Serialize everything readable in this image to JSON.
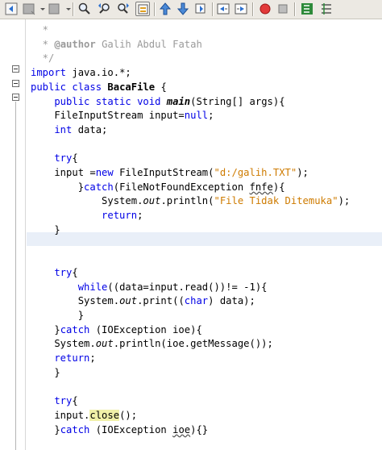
{
  "toolbar": {
    "buttons": [
      {
        "name": "back-icon"
      },
      {
        "name": "forward-icon"
      },
      {
        "name": "last-edit-icon"
      },
      {
        "name": "find-selection-icon"
      },
      {
        "name": "find-previous-icon"
      },
      {
        "name": "find-next-icon"
      },
      {
        "name": "toggle-highlight-icon"
      },
      {
        "name": "previous-bookmark-icon"
      },
      {
        "name": "next-bookmark-icon"
      },
      {
        "name": "toggle-bookmark-icon"
      },
      {
        "name": "shift-left-icon"
      },
      {
        "name": "shift-right-icon"
      },
      {
        "name": "start-macro-icon"
      },
      {
        "name": "stop-macro-icon"
      },
      {
        "name": "comment-icon"
      },
      {
        "name": "uncomment-icon"
      }
    ],
    "colors": {
      "background": "#ece9e3",
      "record": "#e23a3a"
    }
  },
  "editor": {
    "colors": {
      "keyword": "#0000e6",
      "comment": "#9a9a9a",
      "string": "#ce7b00",
      "current_line": "#e9eff8"
    },
    "lines": [
      {
        "id": "l1",
        "t": [
          {
            "c": "cmt",
            "v": "  *"
          }
        ]
      },
      {
        "id": "l2",
        "t": [
          {
            "c": "cmt",
            "v": "  * "
          },
          {
            "c": "cmt bold",
            "v": "@author"
          },
          {
            "c": "cmt",
            "v": " Galih Abdul Fatah"
          }
        ]
      },
      {
        "id": "l3",
        "t": [
          {
            "c": "cmt",
            "v": "  */"
          }
        ]
      },
      {
        "id": "l4",
        "t": [
          {
            "c": "kw",
            "v": "import"
          },
          {
            "c": "",
            "v": " java.io.*;"
          }
        ]
      },
      {
        "id": "l5",
        "t": [
          {
            "c": "kw",
            "v": "public class"
          },
          {
            "c": "",
            "v": " "
          },
          {
            "c": "bold",
            "v": "BacaFile"
          },
          {
            "c": "",
            "v": " {"
          }
        ]
      },
      {
        "id": "l6",
        "t": [
          {
            "c": "kw",
            "v": "    public static void"
          },
          {
            "c": "",
            "v": " "
          },
          {
            "c": "bi",
            "v": "main"
          },
          {
            "c": "",
            "v": "(String[] args){"
          }
        ]
      },
      {
        "id": "l7",
        "t": [
          {
            "c": "",
            "v": "    FileInputStream input="
          },
          {
            "c": "kw",
            "v": "null"
          },
          {
            "c": "",
            "v": ";"
          }
        ]
      },
      {
        "id": "l8",
        "t": [
          {
            "c": "kw",
            "v": "    int"
          },
          {
            "c": "",
            "v": " data;"
          }
        ]
      },
      {
        "id": "l9",
        "t": []
      },
      {
        "id": "l10",
        "t": [
          {
            "c": "kw",
            "v": "    try"
          },
          {
            "c": "",
            "v": "{"
          }
        ]
      },
      {
        "id": "l11",
        "t": [
          {
            "c": "",
            "v": "    input ="
          },
          {
            "c": "kw",
            "v": "new"
          },
          {
            "c": "",
            "v": " FileInputStream("
          },
          {
            "c": "str",
            "v": "\"d:/galih.TXT\""
          },
          {
            "c": "",
            "v": ");"
          }
        ]
      },
      {
        "id": "l12",
        "t": [
          {
            "c": "",
            "v": "        }"
          },
          {
            "c": "kw",
            "v": "catch"
          },
          {
            "c": "",
            "v": "(FileNotFoundException "
          },
          {
            "c": "ul",
            "v": "fnfe"
          },
          {
            "c": "",
            "v": "){"
          }
        ]
      },
      {
        "id": "l13",
        "t": [
          {
            "c": "",
            "v": "            System."
          },
          {
            "c": "it",
            "v": "out"
          },
          {
            "c": "",
            "v": ".println("
          },
          {
            "c": "str",
            "v": "\"File Tidak Ditemuka\""
          },
          {
            "c": "",
            "v": ");"
          }
        ]
      },
      {
        "id": "l14",
        "t": [
          {
            "c": "kw",
            "v": "            return"
          },
          {
            "c": "",
            "v": ";"
          }
        ]
      },
      {
        "id": "l15",
        "t": [
          {
            "c": "",
            "v": "    }"
          }
        ]
      },
      {
        "id": "l16",
        "t": []
      },
      {
        "id": "l17",
        "t": []
      },
      {
        "id": "l18",
        "t": [
          {
            "c": "kw",
            "v": "    try"
          },
          {
            "c": "",
            "v": "{"
          }
        ]
      },
      {
        "id": "l19",
        "t": [
          {
            "c": "kw",
            "v": "        while"
          },
          {
            "c": "",
            "v": "((data=input.read())!= -1){"
          }
        ]
      },
      {
        "id": "l20",
        "t": [
          {
            "c": "",
            "v": "        System."
          },
          {
            "c": "it",
            "v": "out"
          },
          {
            "c": "",
            "v": ".print(("
          },
          {
            "c": "kw",
            "v": "char"
          },
          {
            "c": "",
            "v": ") data);"
          }
        ]
      },
      {
        "id": "l21",
        "t": [
          {
            "c": "",
            "v": "        }"
          }
        ]
      },
      {
        "id": "l22",
        "t": [
          {
            "c": "",
            "v": "    }"
          },
          {
            "c": "kw",
            "v": "catch"
          },
          {
            "c": "",
            "v": " (IOException ioe){"
          }
        ]
      },
      {
        "id": "l23",
        "t": [
          {
            "c": "",
            "v": "    System."
          },
          {
            "c": "it",
            "v": "out"
          },
          {
            "c": "",
            "v": ".println(ioe.getMessage());"
          }
        ]
      },
      {
        "id": "l24",
        "t": [
          {
            "c": "kw",
            "v": "    return"
          },
          {
            "c": "",
            "v": ";"
          }
        ]
      },
      {
        "id": "l25",
        "t": [
          {
            "c": "",
            "v": "    }"
          }
        ]
      },
      {
        "id": "l26",
        "t": []
      },
      {
        "id": "l27",
        "t": [
          {
            "c": "kw",
            "v": "    try"
          },
          {
            "c": "",
            "v": "{"
          }
        ]
      },
      {
        "id": "l28",
        "t": [
          {
            "c": "",
            "v": "    input."
          },
          {
            "c": "mark",
            "v": "close"
          },
          {
            "c": "",
            "v": "();"
          }
        ]
      },
      {
        "id": "l29",
        "t": [
          {
            "c": "",
            "v": "    }"
          },
          {
            "c": "kw",
            "v": "catch"
          },
          {
            "c": "",
            "v": " (IOException "
          },
          {
            "c": "ul",
            "v": "ioe"
          },
          {
            "c": "",
            "v": "){}"
          }
        ]
      }
    ]
  }
}
